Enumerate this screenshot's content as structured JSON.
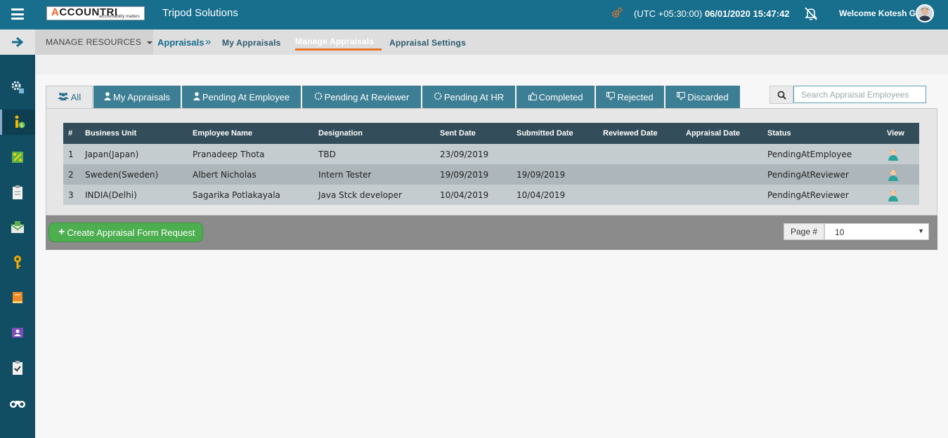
{
  "header": {
    "logo_text": "ACCOUNTRI",
    "logo_tagline": "accountability matters",
    "company": "Tripod Solutions",
    "timezone": "(UTC +05:30:00)",
    "datetime": "06/01/2020 15:47:42",
    "welcome": "Welcome Kotesh G"
  },
  "subnav": {
    "manage_resources": "MANAGE RESOURCES",
    "breadcrumb_root": "Appraisals",
    "tabs": [
      {
        "label": "My Appraisals"
      },
      {
        "label": "Manage Appraisals"
      },
      {
        "label": "Appraisal Settings"
      }
    ]
  },
  "filters": [
    {
      "label": "All",
      "icon": "users-icon"
    },
    {
      "label": "My Appraisals",
      "icon": "user-icon"
    },
    {
      "label": "Pending At Employee",
      "icon": "user-icon"
    },
    {
      "label": "Pending At Reviewer",
      "icon": "spinner-icon"
    },
    {
      "label": "Pending At HR",
      "icon": "spinner-icon"
    },
    {
      "label": "Completed",
      "icon": "thumbs-up-icon"
    },
    {
      "label": "Rejected",
      "icon": "thumbs-down-icon"
    },
    {
      "label": "Discarded",
      "icon": "thumbs-down-icon"
    }
  ],
  "search": {
    "placeholder": "Search Appraisal Employees"
  },
  "table": {
    "headers": [
      "#",
      "Business Unit",
      "Employee Name",
      "Designation",
      "Sent Date",
      "Submitted Date",
      "Reviewed Date",
      "Appraisal Date",
      "Status",
      "View"
    ],
    "rows": [
      [
        "1",
        "Japan(Japan)",
        "Pranadeep Thota",
        "TBD",
        "23/09/2019",
        "",
        "",
        "",
        "PendingAtEmployee"
      ],
      [
        "2",
        "Sweden(Sweden)",
        "Albert Nicholas",
        "Intern Tester",
        "19/09/2019",
        "19/09/2019",
        "",
        "",
        "PendingAtReviewer"
      ],
      [
        "3",
        "INDIA(Delhi)",
        "Sagarika Potlakayala",
        "Java Stck developer",
        "10/04/2019",
        "10/04/2019",
        "",
        "",
        "PendingAtReviewer"
      ]
    ]
  },
  "footer": {
    "create_label": "Create Appraisal Form Request",
    "page_label": "Page #",
    "page_size": "10"
  },
  "leftnav_icons": [
    "settings-icon",
    "person-money-icon",
    "percent-icon",
    "clipboard-icon",
    "inbox-icon",
    "key-icon",
    "book-icon",
    "id-card-icon",
    "checklist-icon",
    "binoculars-icon"
  ],
  "colors": {
    "topbar": "#176e8d",
    "leftnav": "#114e63",
    "accent_orange": "#e8742a",
    "create_green": "#4cae4f"
  }
}
